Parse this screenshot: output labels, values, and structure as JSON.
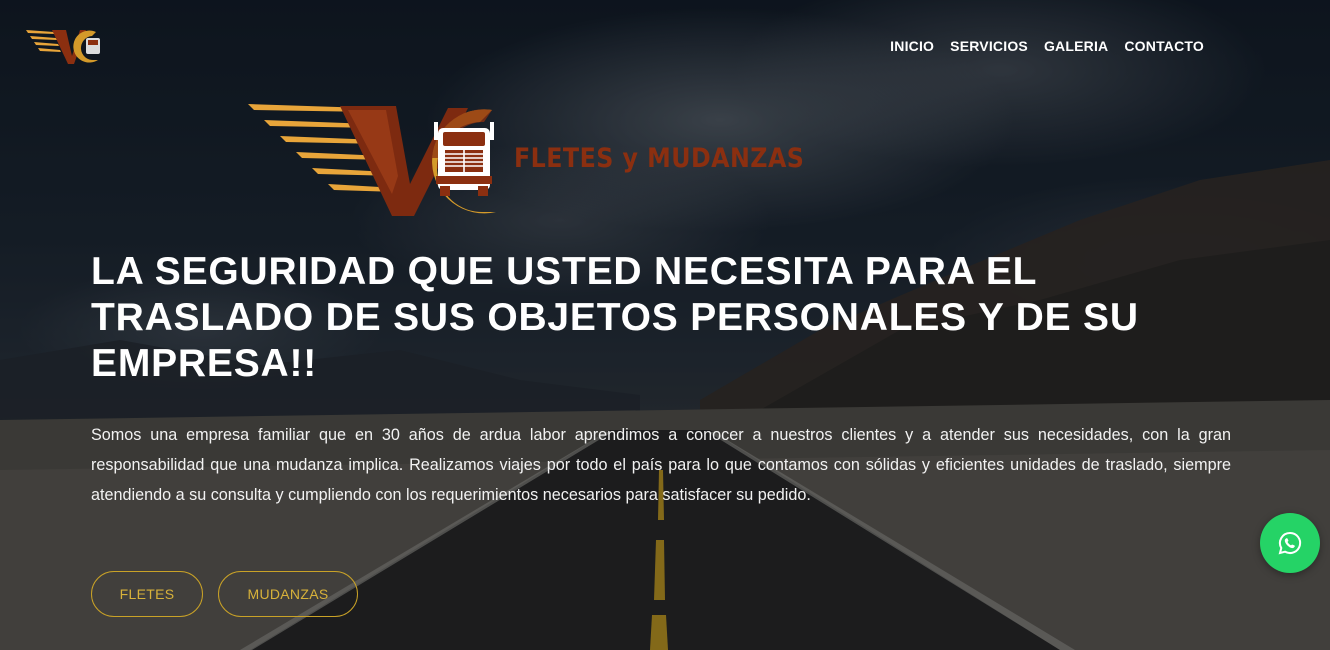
{
  "nav": {
    "items": [
      "INICIO",
      "SERVICIOS",
      "GALERIA",
      "CONTACTO"
    ]
  },
  "brand": {
    "monogram": "VC",
    "tagline": "FLETES y MUDANZAS"
  },
  "hero": {
    "headline_lines": [
      "LA SEGURIDAD QUE USTED NECESITA PARA EL",
      "TRASLADO DE SUS OBJETOS PERSONALES Y DE SU",
      "EMPRESA!!"
    ],
    "description": "Somos una empresa familiar que en 30 años de ardua labor aprendimos a conocer a nuestros clientes y a atender sus necesidades, con la gran responsabilidad que una mudanza implica. Realizamos viajes por todo el país para lo que contamos con sólidas y eficientes unidades de traslado, siempre atendiendo a su consulta y cumpliendo con los requerimientos necesarios para satisfacer su pedido.",
    "buttons": {
      "fletes": "FLETES",
      "mudanzas": "MUDANZAS"
    }
  },
  "icons": {
    "whatsapp": "whatsapp-icon",
    "truck": "truck-icon"
  },
  "colors": {
    "accent_gold": "#c9a227",
    "brand_red": "#8b2f10",
    "whatsapp_green": "#25d366"
  }
}
